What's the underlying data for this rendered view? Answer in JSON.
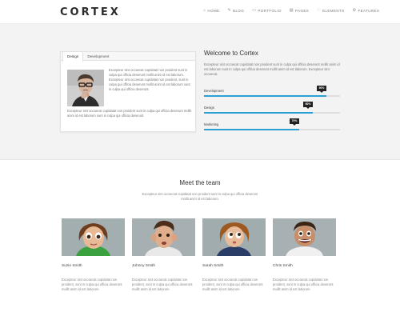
{
  "brand": {
    "logo": "CORTEX"
  },
  "nav": [
    {
      "label": "HOME",
      "icon": "home-icon",
      "glyph": "⌂"
    },
    {
      "label": "BLOG",
      "icon": "pencil-icon",
      "glyph": "✎"
    },
    {
      "label": "PORTFOLIO",
      "icon": "folder-icon",
      "glyph": "▭"
    },
    {
      "label": "PAGES",
      "icon": "pages-icon",
      "glyph": "▤"
    },
    {
      "label": "ELEMENTS",
      "icon": "heart-icon",
      "glyph": "♡"
    },
    {
      "label": "FEATURES",
      "icon": "gear-icon",
      "glyph": "⚙"
    }
  ],
  "tabs": {
    "items": [
      "Design",
      "Development"
    ],
    "text": "Excepteur sint occaecat cupidatat non proident sunt in culpa qui officia deserunt mollit anim id est laborum. Excepteur sint occaecat cupidatat non proident, sunt in culpa qui officia deserunt mollit anim id est laborum sunt in culpa qui officia deserunt.",
    "text2": "Excepteur sint occaecat cupidatat non proident sunt in culpa qui officia deserunt mollit anim id est laborum sunt in culpa qui officia deserunt."
  },
  "welcome": {
    "title": "Welcome to Cortex",
    "text": "Excepteur sint occaecat cupidatat non proident sunt in culpa qui officia deserunt mollit anim id est laborum sunt in culpa qui officia deserunt mollit anim id est laborum. Excepteur sint occaecat."
  },
  "skills": [
    {
      "label": "Development",
      "percent": 90,
      "badge": "90%"
    },
    {
      "label": "Design",
      "percent": 80,
      "badge": "80%"
    },
    {
      "label": "Marketing",
      "percent": 70,
      "badge": "70%"
    }
  ],
  "team": {
    "title": "Meet the team",
    "intro": "Excepteur sint occaecat cupidatat non proident sunt in culpa qui officia deserunt mollit anim id est laborum.",
    "members": [
      {
        "name": "Suzie Smith",
        "bio": "Excepteur sint occaecat cupidatat non proident, sunt in culpa qui officia deserunt mollit anim id est laborum."
      },
      {
        "name": "Johnny Smith",
        "bio": "Excepteur sint occaecat cupidatat non proident, sunt in culpa qui officia deserunt mollit anim id est laborum."
      },
      {
        "name": "Sarah Smith",
        "bio": "Excepteur sint occaecat cupidatat non proident, sunt in culpa qui officia deserunt mollit anim id est laborum."
      },
      {
        "name": "Chris Smith",
        "bio": "Excepteur sint occaecat cupidatat non proident, sunt in culpa qui officia deserunt mollit anim id est laborum."
      }
    ]
  },
  "colors": {
    "accent": "#2aa0d6",
    "badge": "#222222",
    "section_bg": "#f3f3f3"
  }
}
